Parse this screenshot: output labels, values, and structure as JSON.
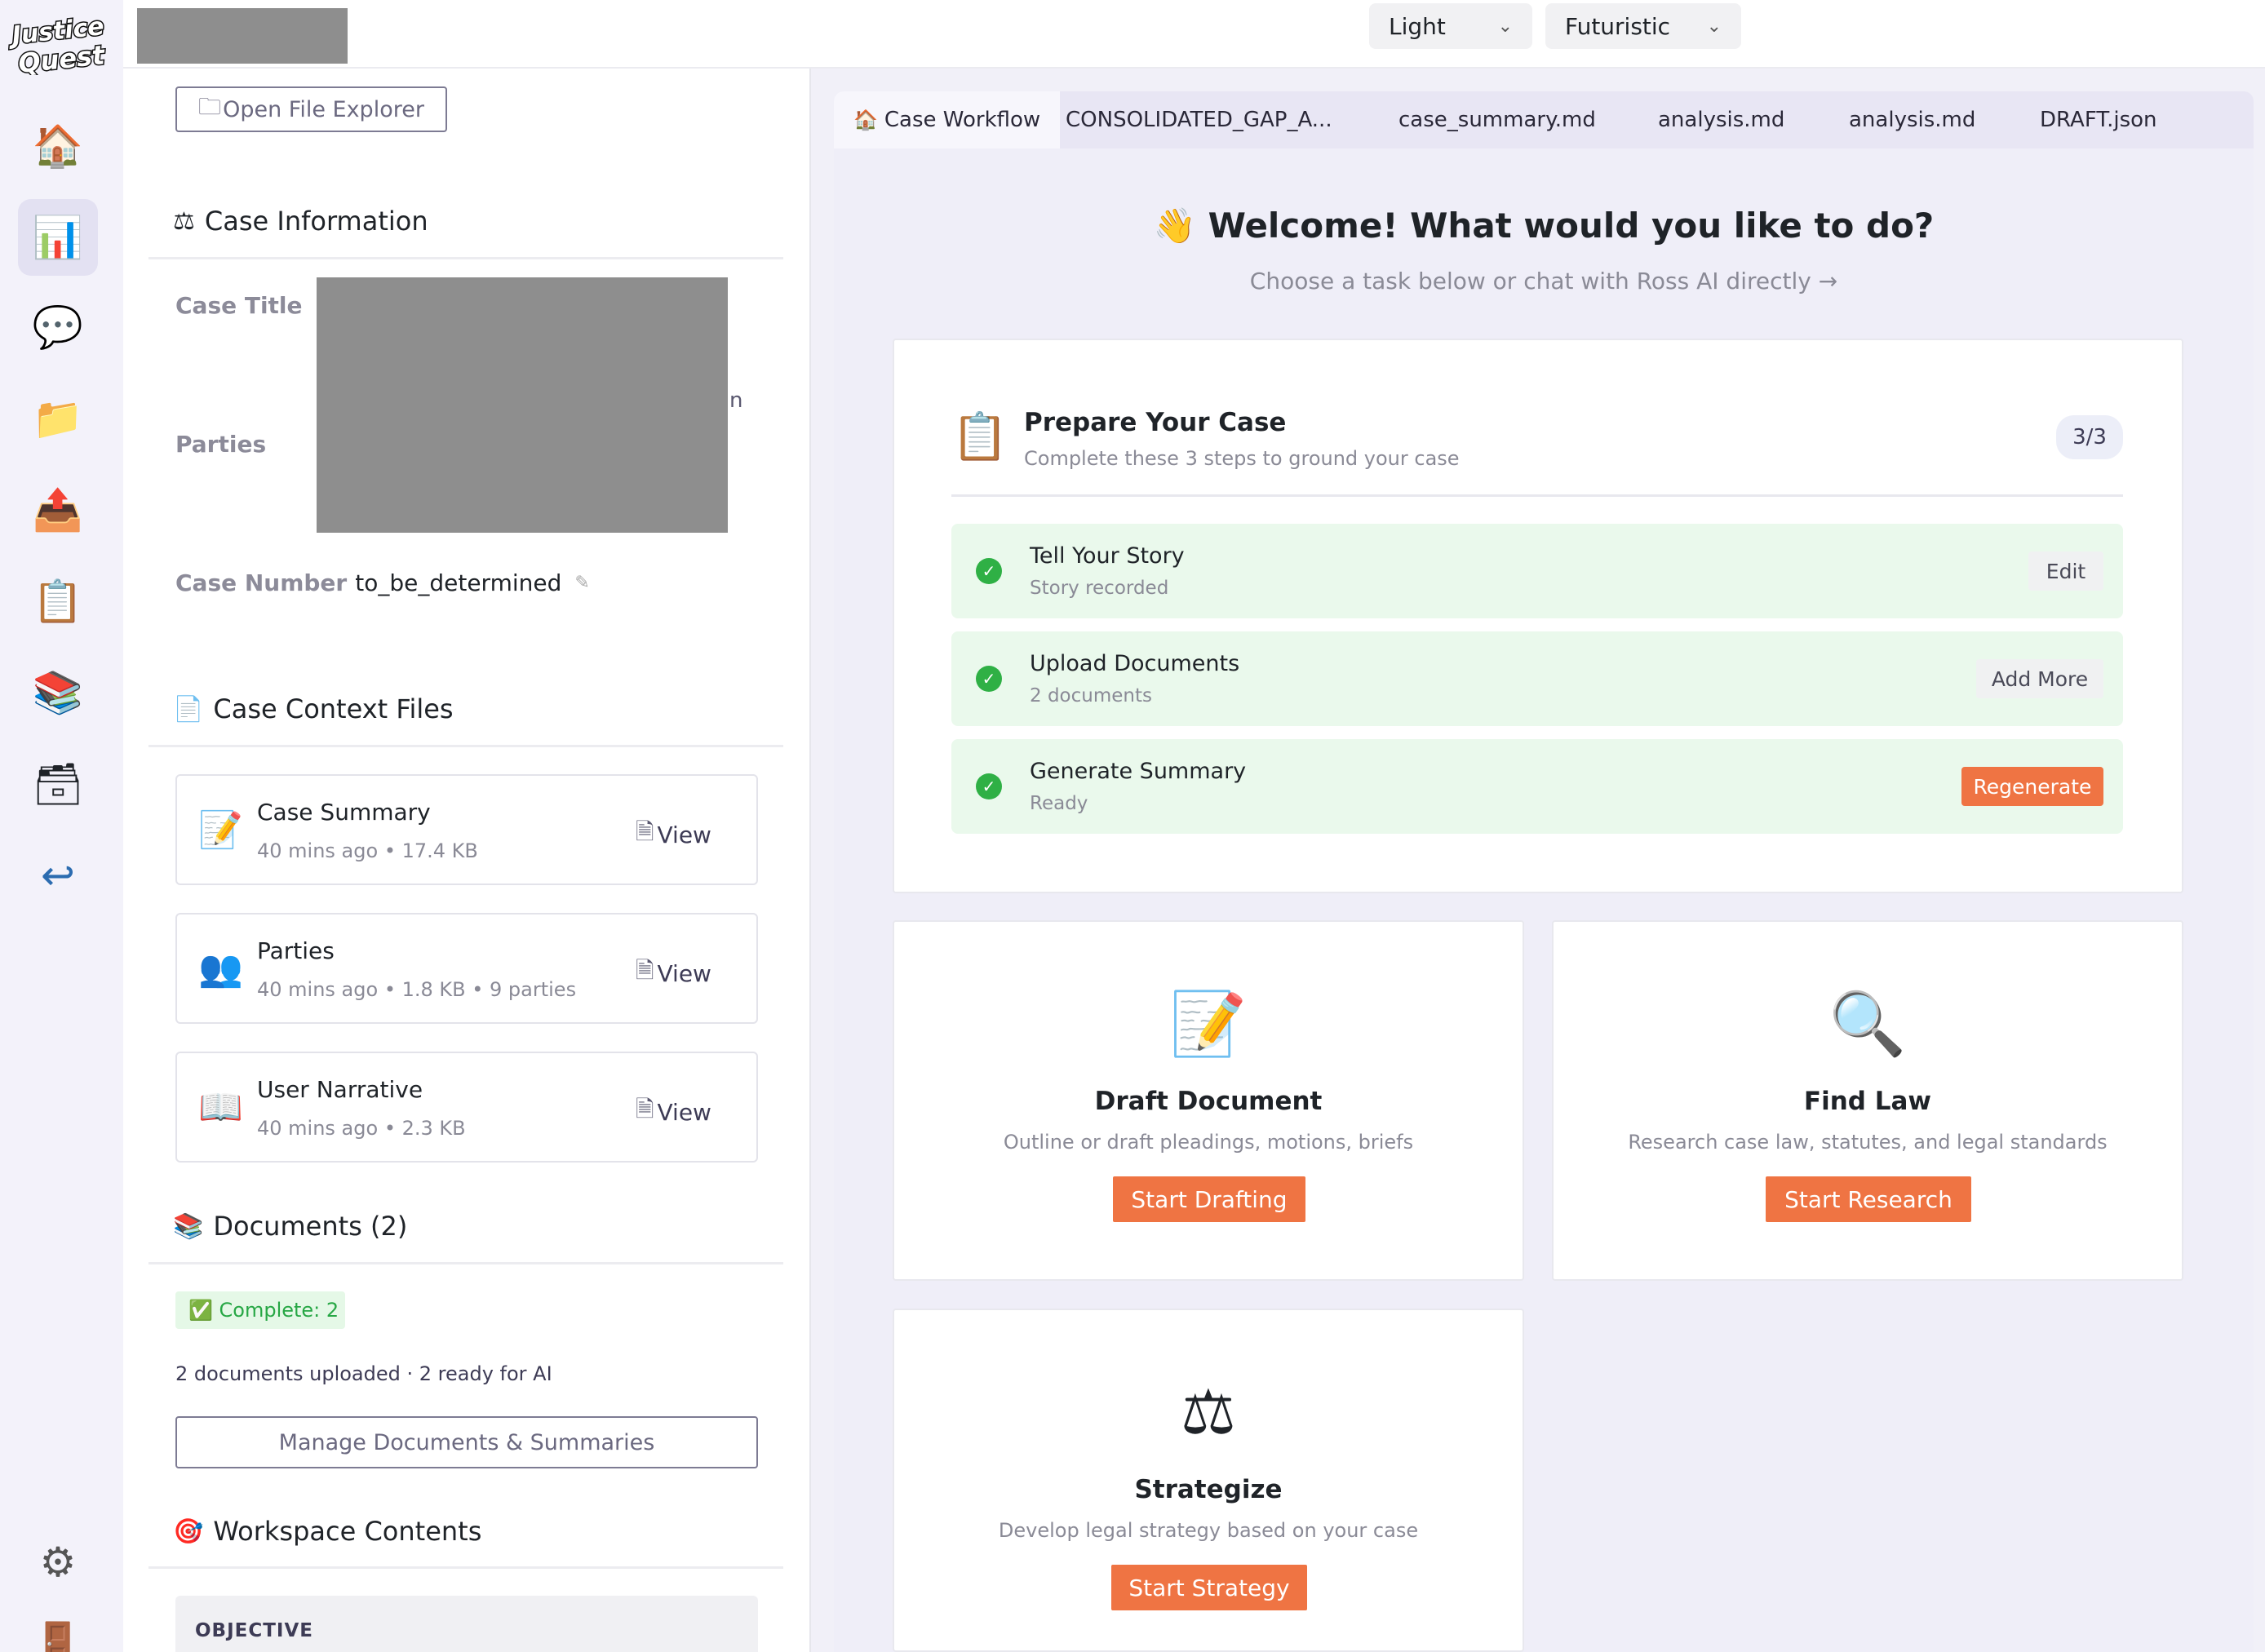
{
  "app": {
    "logo_text": "Justice Quest"
  },
  "rail": {
    "items": [
      {
        "name": "home",
        "glyph": "🏠"
      },
      {
        "name": "dashboard",
        "glyph": "📊"
      },
      {
        "name": "chat",
        "glyph": "💬"
      },
      {
        "name": "folder",
        "glyph": "📁"
      },
      {
        "name": "upload",
        "glyph": "📤"
      },
      {
        "name": "clipboard",
        "glyph": "📋"
      },
      {
        "name": "books",
        "glyph": "📚"
      },
      {
        "name": "archive",
        "glyph": "🗃"
      },
      {
        "name": "return",
        "glyph": "↩"
      },
      {
        "name": "settings",
        "glyph": "⚙"
      },
      {
        "name": "door",
        "glyph": "🚪"
      }
    ]
  },
  "topbar": {
    "theme_select": "Light",
    "style_select": "Futuristic"
  },
  "left": {
    "open_file_explorer": "Open File Explorer",
    "case_info": {
      "title": "Case Information",
      "case_title_label": "Case Title",
      "parties_label": "Parties",
      "parties_trailing": "n",
      "case_number_label": "Case Number",
      "case_number_value": "to_be_determined"
    },
    "context_files": {
      "title": "Case Context Files",
      "view_label": "View",
      "items": [
        {
          "name": "Case Summary",
          "meta": "40 mins ago • 17.4 KB",
          "glyph": "📝"
        },
        {
          "name": "Parties",
          "meta": "40 mins ago • 1.8 KB • 9 parties",
          "glyph": "👥"
        },
        {
          "name": "User Narrative",
          "meta": "40 mins ago • 2.3 KB",
          "glyph": "📖"
        }
      ]
    },
    "documents": {
      "title": "Documents (2)",
      "badge": "✅ Complete: 2",
      "summary": "2 documents uploaded · 2 ready for AI",
      "manage_button": "Manage Documents & Summaries"
    },
    "workspace": {
      "title": "Workspace Contents",
      "objective_label": "OBJECTIVE"
    }
  },
  "tabs": [
    {
      "label": "Case Workflow",
      "glyph": "🏠"
    },
    {
      "label": "CONSOLIDATED_GAP_A..."
    },
    {
      "label": "case_summary.md"
    },
    {
      "label": "analysis.md"
    },
    {
      "label": "analysis.md"
    },
    {
      "label": "DRAFT.json"
    }
  ],
  "main": {
    "welcome_title": "Welcome! What would you like to do?",
    "welcome_glyph": "👋",
    "welcome_sub": "Choose a task below or chat with Ross AI directly →",
    "prepare": {
      "title": "Prepare Your Case",
      "subtitle": "Complete these 3 steps to ground your case",
      "progress": "3/3",
      "steps": [
        {
          "title": "Tell Your Story",
          "status": "Story recorded",
          "action": "Edit"
        },
        {
          "title": "Upload Documents",
          "status": "2 documents",
          "action": "Add More"
        },
        {
          "title": "Generate Summary",
          "status": "Ready",
          "action": "Regenerate"
        }
      ]
    },
    "tasks": [
      {
        "title": "Draft Document",
        "desc": "Outline or draft pleadings, motions, briefs",
        "button": "Start Drafting",
        "glyph": "📝"
      },
      {
        "title": "Find Law",
        "desc": "Research case law, statutes, and legal standards",
        "button": "Start Research",
        "glyph": "🔍"
      },
      {
        "title": "Strategize",
        "desc": "Develop legal strategy based on your case",
        "button": "Start Strategy",
        "glyph": "⚖"
      }
    ]
  },
  "colors": {
    "accent_orange": "#ef7443",
    "success_green": "#2fb045",
    "step_bg": "#eaf9ec",
    "panel_bg": "#f1f0f8",
    "redaction": "#8e8e8e"
  }
}
